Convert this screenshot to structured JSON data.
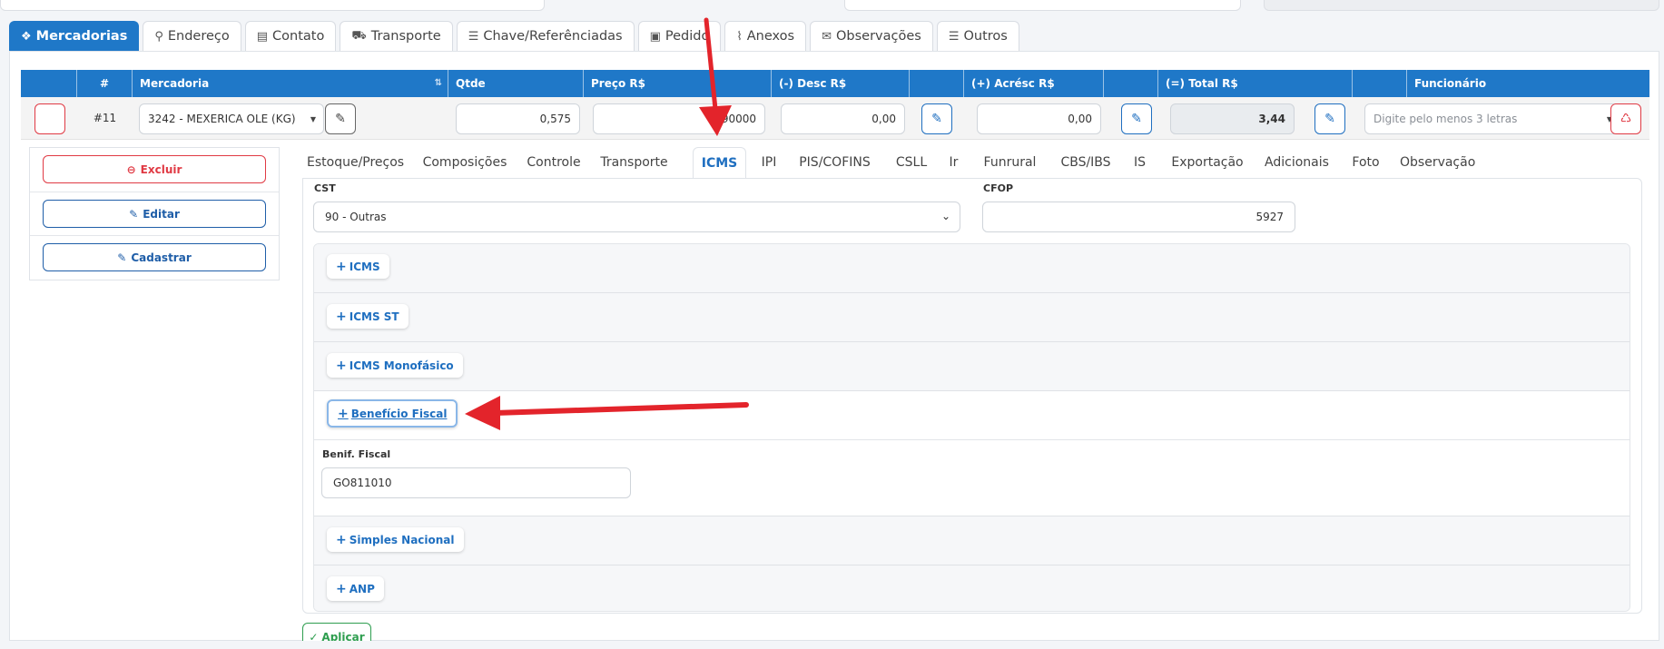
{
  "top_tabs": [
    {
      "label": "Mercadorias",
      "icon": "cubes-icon",
      "active": true
    },
    {
      "label": "Endereço",
      "icon": "map-icon"
    },
    {
      "label": "Contato",
      "icon": "id-card-icon"
    },
    {
      "label": "Transporte",
      "icon": "truck-icon"
    },
    {
      "label": "Chave/Referênciadas",
      "icon": "list-icon"
    },
    {
      "label": "Pedido",
      "icon": "clipboard-check-icon"
    },
    {
      "label": "Anexos",
      "icon": "paperclip-icon"
    },
    {
      "label": "Observações",
      "icon": "comments-icon"
    },
    {
      "label": "Outros",
      "icon": "list-icon"
    }
  ],
  "grid": {
    "headers": {
      "num": "#",
      "mercadoria": "Mercadoria",
      "qtde": "Qtde",
      "preco": "Preço R$",
      "desc": "(-) Desc R$",
      "acresc": "(+) Acrésc R$",
      "total": "(=) Total R$",
      "funcionario": "Funcionário"
    },
    "row": {
      "num": "#11",
      "mercadoria": "3242 - MEXERICA OLE (KG)",
      "qtde": "0,575",
      "preco": "90000",
      "desc": "0,00",
      "acresc": "0,00",
      "total": "3,44",
      "funcionario_placeholder": "Digite pelo menos 3 letras"
    }
  },
  "actions": {
    "excluir": "Excluir",
    "editar": "Editar",
    "cadastrar": "Cadastrar"
  },
  "sub_tabs": [
    "Estoque/Preços",
    "Composições",
    "Controle",
    "Transporte",
    "ICMS",
    "IPI",
    "PIS/COFINS",
    "CSLL",
    "Ir",
    "Funrural",
    "CBS/IBS",
    "IS",
    "Exportação",
    "Adicionais",
    "Foto",
    "Observação"
  ],
  "active_sub_tab": "ICMS",
  "icms": {
    "cst_label": "CST",
    "cst_value": "90 - Outras",
    "cfop_label": "CFOP",
    "cfop_value": "5927",
    "sections": [
      "ICMS",
      "ICMS ST",
      "ICMS Monofásico",
      "Benefício Fiscal",
      "Simples Nacional",
      "ANP"
    ],
    "benef_label": "Benif. Fiscal",
    "benef_value": "GO811010"
  },
  "apply_label": "Aplicar",
  "colors": {
    "primary": "#1f78c8",
    "danger": "#e03a44",
    "success": "#2e9e4f",
    "annotation_arrow": "#e3242b"
  }
}
